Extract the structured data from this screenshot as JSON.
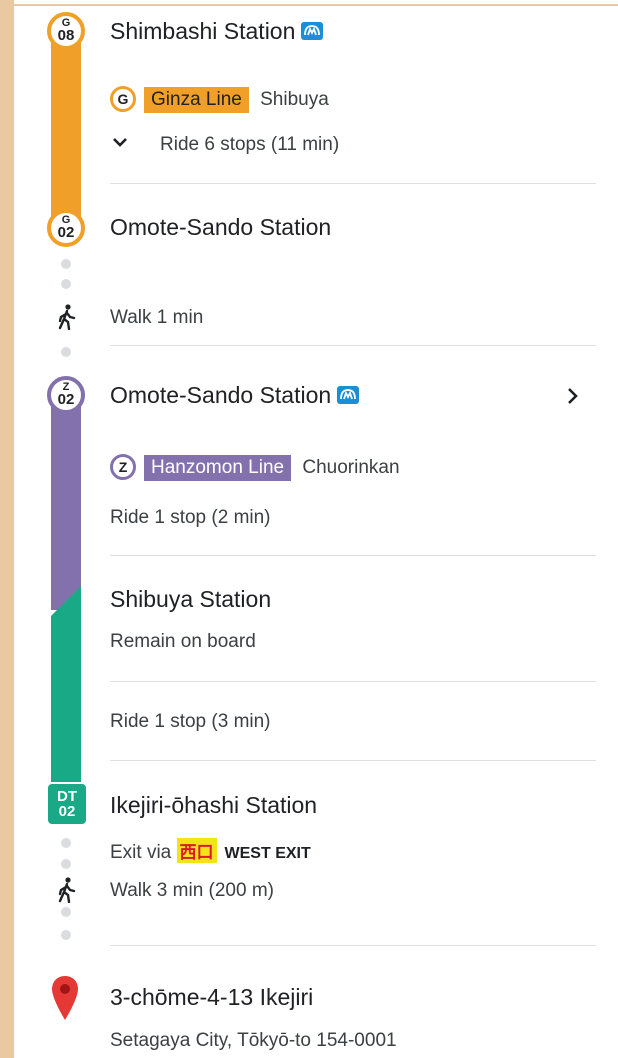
{
  "route": {
    "step1": {
      "badge_letter": "G",
      "badge_number": "08",
      "station": "Shimbashi Station",
      "line_letter": "G",
      "line_name": "Ginza Line",
      "direction": "Shibuya",
      "ride": "Ride 6 stops (11 min)"
    },
    "step2": {
      "badge_letter": "G",
      "badge_number": "02",
      "station": "Omote-Sando Station",
      "walk": "Walk 1 min"
    },
    "step3": {
      "badge_letter": "Z",
      "badge_number": "02",
      "station": "Omote-Sando Station",
      "line_letter": "Z",
      "line_name": "Hanzomon Line",
      "direction": "Chuorinkan",
      "ride": "Ride 1 stop (2 min)"
    },
    "step4": {
      "station": "Shibuya Station",
      "note": "Remain on board",
      "ride": "Ride 1 stop (3 min)"
    },
    "step5": {
      "badge_letter": "DT",
      "badge_number": "02",
      "station": "Ikejiri-ōhashi Station",
      "exit_prefix": "Exit via",
      "exit_kanji": "西口",
      "exit_name": "WEST EXIT",
      "walk": "Walk 3 min (200 m)"
    },
    "destination": {
      "address": "3-chōme-4-13 Ikejiri",
      "locality": "Setagaya City, Tōkyō-to 154-0001"
    }
  },
  "colors": {
    "ginza": "#f0a028",
    "hanzomon": "#8371ad",
    "denentoshi": "#1aa986",
    "metro_icon": "#1a8fd7",
    "pin": "#e53935"
  },
  "icons": [
    "metro-icon",
    "chevron-down-icon",
    "chevron-right-icon",
    "walk-icon",
    "location-pin-icon"
  ]
}
